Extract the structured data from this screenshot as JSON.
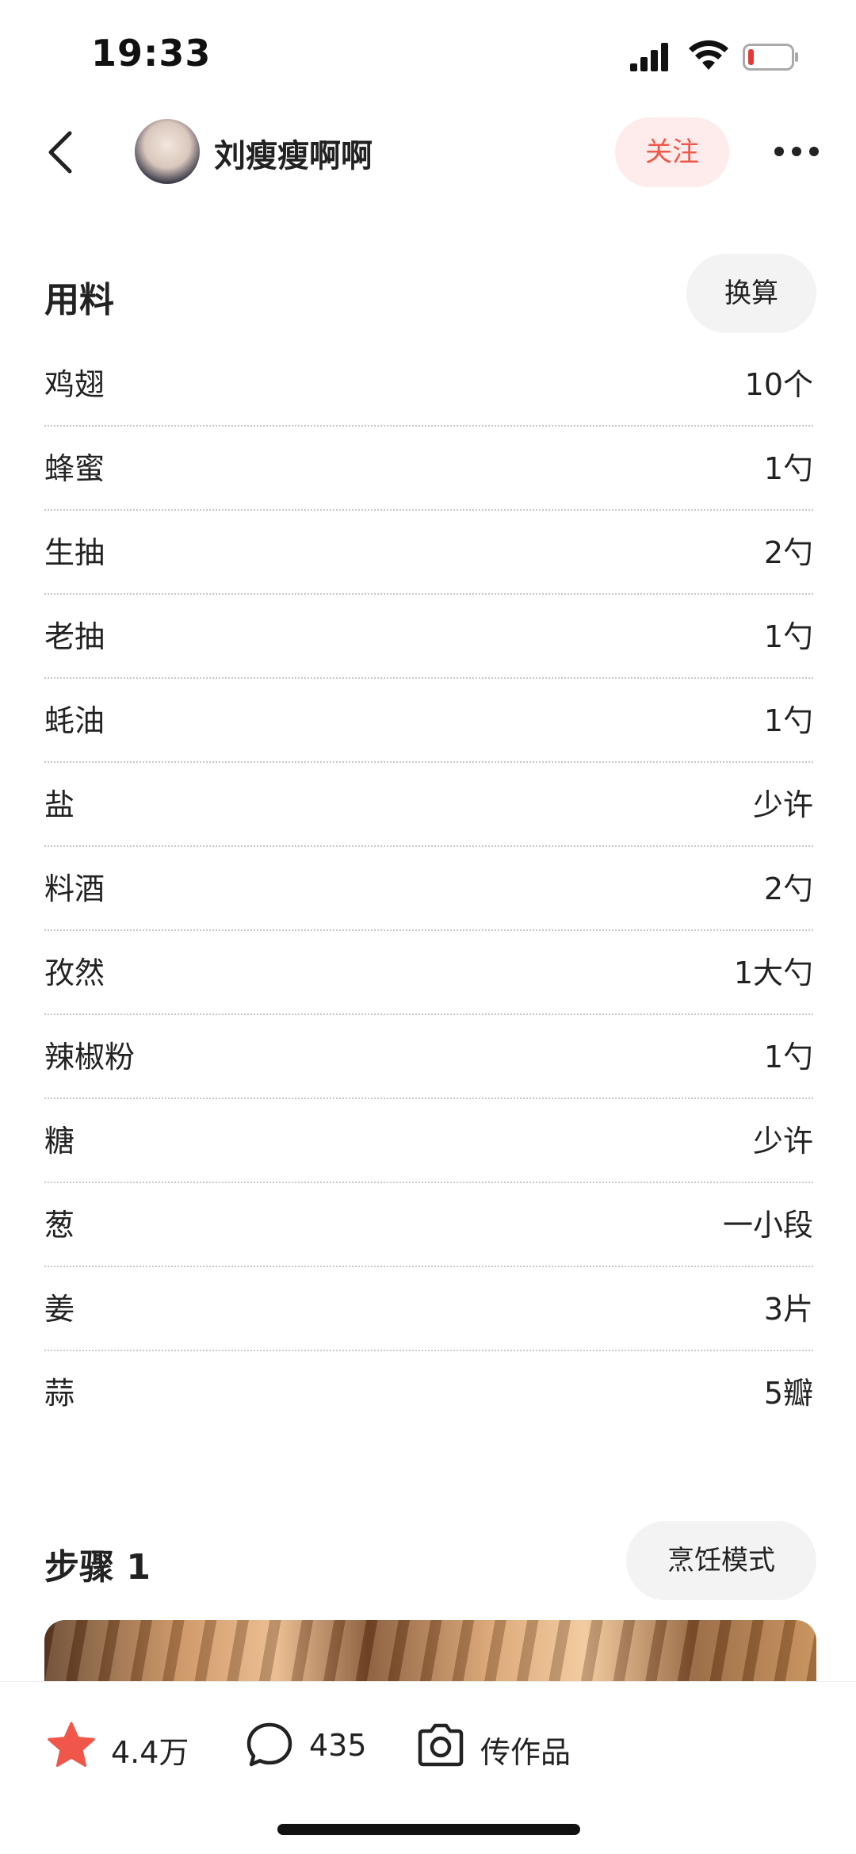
{
  "status_bar": {
    "time": "19:33"
  },
  "header": {
    "username": "刘瘦瘦啊啊",
    "follow_label": "关注"
  },
  "ingredients": {
    "title": "用料",
    "convert_label": "换算",
    "items": [
      {
        "name": "鸡翅",
        "qty": "10个"
      },
      {
        "name": "蜂蜜",
        "qty": "1勺"
      },
      {
        "name": "生抽",
        "qty": "2勺"
      },
      {
        "name": "老抽",
        "qty": "1勺"
      },
      {
        "name": "蚝油",
        "qty": "1勺"
      },
      {
        "name": "盐",
        "qty": "少许"
      },
      {
        "name": "料酒",
        "qty": "2勺"
      },
      {
        "name": "孜然",
        "qty": "1大勺"
      },
      {
        "name": "辣椒粉",
        "qty": "1勺"
      },
      {
        "name": "糖",
        "qty": "少许"
      },
      {
        "name": "葱",
        "qty": "一小段"
      },
      {
        "name": "姜",
        "qty": "3片"
      },
      {
        "name": "蒜",
        "qty": "5瓣"
      }
    ]
  },
  "step": {
    "title": "步骤 1",
    "cook_mode_label": "烹饪模式"
  },
  "bottom_bar": {
    "favorites": "4.4万",
    "comments": "435",
    "upload_label": "传作品"
  },
  "colors": {
    "accent": "#f0574a",
    "follow_bg": "#fdeceb",
    "star": "#f0574a"
  }
}
